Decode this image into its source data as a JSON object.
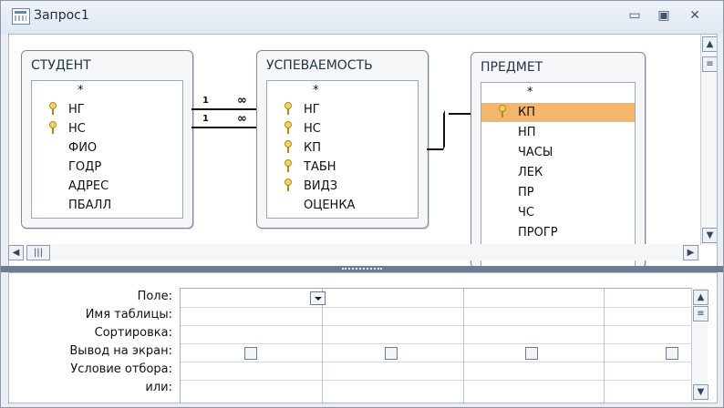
{
  "window": {
    "title": "Запрос1",
    "minimize": "▭",
    "maximize": "▣",
    "close": "✕"
  },
  "tables": [
    {
      "name": "СТУДЕНТ",
      "fields": [
        {
          "name": "*",
          "key": false
        },
        {
          "name": "НГ",
          "key": true
        },
        {
          "name": "НС",
          "key": true
        },
        {
          "name": "ФИО",
          "key": false
        },
        {
          "name": "ГОДР",
          "key": false
        },
        {
          "name": "АДРЕС",
          "key": false
        },
        {
          "name": "ПБАЛЛ",
          "key": false
        }
      ]
    },
    {
      "name": "УСПЕВАЕМОСТЬ",
      "fields": [
        {
          "name": "*",
          "key": false
        },
        {
          "name": "НГ",
          "key": true
        },
        {
          "name": "НС",
          "key": true
        },
        {
          "name": "КП",
          "key": true
        },
        {
          "name": "ТАБН",
          "key": true
        },
        {
          "name": "ВИДЗ",
          "key": true
        },
        {
          "name": "ОЦЕНКА",
          "key": false
        }
      ]
    },
    {
      "name": "ПРЕДМЕТ",
      "fields": [
        {
          "name": "*",
          "key": false
        },
        {
          "name": "КП",
          "key": true,
          "selected": true
        },
        {
          "name": "НП",
          "key": false
        },
        {
          "name": "ЧАСЫ",
          "key": false
        },
        {
          "name": "ЛЕК",
          "key": false
        },
        {
          "name": "ПР",
          "key": false
        },
        {
          "name": "ЧС",
          "key": false
        },
        {
          "name": "ПРОГР",
          "key": false
        }
      ]
    }
  ],
  "relations": {
    "one": "1",
    "many": "∞"
  },
  "query_grid": {
    "row_labels": [
      "Поле:",
      "Имя таблицы:",
      "Сортировка:",
      "Вывод на экран:",
      "Условие отбора:",
      "или:"
    ]
  }
}
